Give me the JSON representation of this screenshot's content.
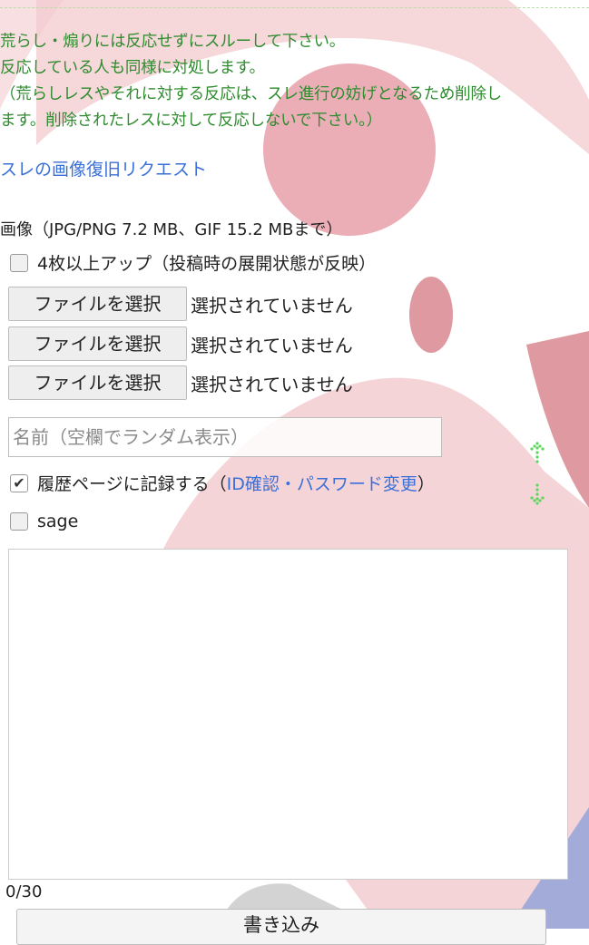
{
  "notice": {
    "line1": "荒らし・煽りには反応せずにスルーして下さい。",
    "line2": "反応している人も同様に対処します。",
    "line3": "（荒らしレスやそれに対する反応は、スレ進行の妨げとなるため削除し",
    "line4": "ます。削除されたレスに対して反応しないで下さい。）"
  },
  "restore_link": "スレの画像復旧リクエスト",
  "image_note": "画像（JPG/PNG 7.2 MB、GIF 15.2 MBまで）",
  "multi_upload": {
    "label": "4枚以上アップ（投稿時の展開状態が反映）",
    "checked": false
  },
  "file_inputs": [
    {
      "button": "ファイルを選択",
      "status": "選択されていません"
    },
    {
      "button": "ファイルを選択",
      "status": "選択されていません"
    },
    {
      "button": "ファイルを選択",
      "status": "選択されていません"
    }
  ],
  "name_field": {
    "placeholder": "名前（空欄でランダム表示）",
    "value": ""
  },
  "history": {
    "label": "履歴ページに記録する（",
    "link": "ID確認・パスワード変更",
    "suffix": "）",
    "checked": true
  },
  "sage": {
    "label": "sage",
    "checked": false
  },
  "message": {
    "value": ""
  },
  "counter": "0/30",
  "submit_label": "書き込み",
  "icons": {
    "scroll_up": "up-arrow-icon",
    "scroll_down": "down-arrow-icon"
  },
  "colors": {
    "notice": "#2e8b2e",
    "link": "#3a6fd8",
    "arrow": "#5cd65c",
    "bg_shape": "#e8a0a8"
  }
}
